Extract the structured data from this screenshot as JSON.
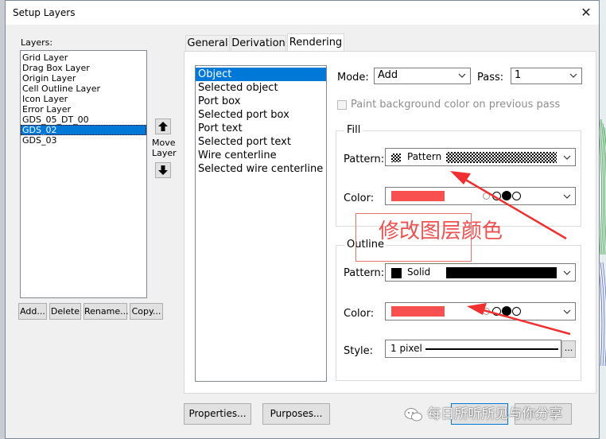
{
  "window": {
    "title": "Setup Layers",
    "close_glyph": "✕"
  },
  "layers": {
    "label": "Layers:",
    "items": [
      "Grid Layer",
      "Drag Box Layer",
      "Origin Layer",
      "Cell Outline Layer",
      "Icon Layer",
      "Error Layer",
      "GDS_05_DT_00",
      "GDS_02",
      "GDS_03"
    ],
    "selected_index": 7,
    "move_label": [
      "Move",
      "Layer"
    ],
    "buttons": {
      "add": "Add...",
      "delete": "Delete",
      "rename": "Rename...",
      "copy": "Copy..."
    }
  },
  "tabs": [
    "General",
    "Derivation",
    "Rendering"
  ],
  "active_tab": 2,
  "render_items": {
    "items": [
      "Object",
      "Selected object",
      "Port box",
      "Selected port box",
      "Port text",
      "Selected port text",
      "Wire centerline",
      "Selected wire centerline"
    ],
    "selected_index": 0
  },
  "mode": {
    "label": "Mode:",
    "value": "Add"
  },
  "pass": {
    "label": "Pass:",
    "value": "1"
  },
  "paint_bg": {
    "label": "Paint background color on previous pass",
    "checked": false
  },
  "fill": {
    "title": "Fill",
    "pattern_label": "Pattern:",
    "pattern_value": "Pattern",
    "color_label": "Color:",
    "color": "#f85050"
  },
  "outline": {
    "title": "Outline",
    "pattern_label": "Pattern:",
    "pattern_value": "Solid",
    "color_label": "Color:",
    "color": "#f85050",
    "style_label": "Style:",
    "style_value": "1 pixel",
    "more_button": "..."
  },
  "footer": {
    "properties": "Properties...",
    "purposes": "Purposes..."
  },
  "annotation": {
    "text": "修改图层颜色",
    "color": "#f05050"
  },
  "watermark": {
    "text": "每日所听所见与你分享"
  }
}
